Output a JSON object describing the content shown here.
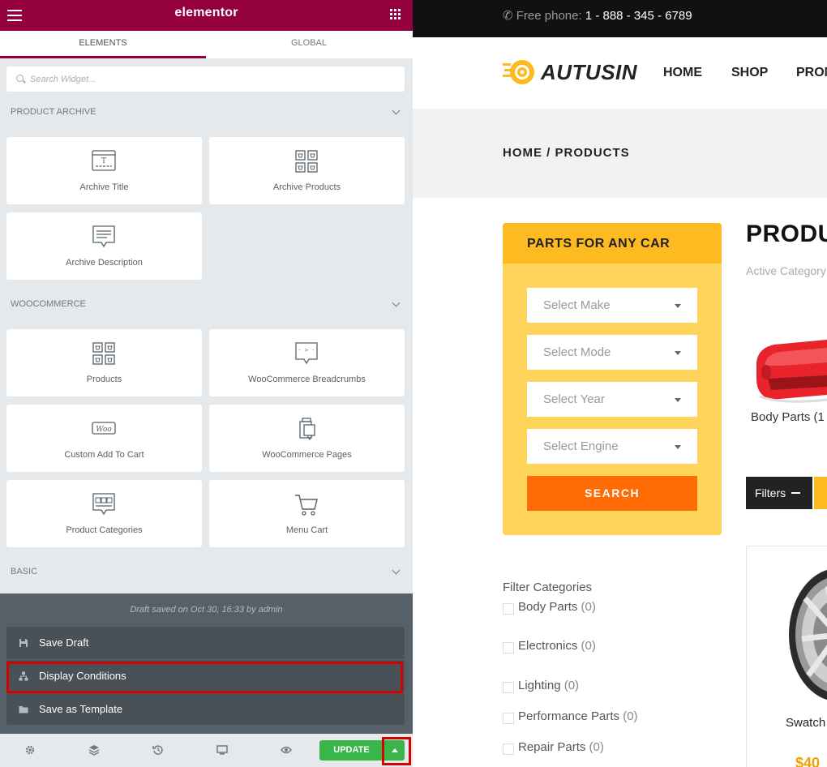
{
  "editor": {
    "brand": "elementor",
    "tabs": {
      "elements": "ELEMENTS",
      "global": "GLOBAL"
    },
    "search_placeholder": "Search Widget...",
    "sections": [
      {
        "title": "PRODUCT ARCHIVE",
        "widgets": [
          "Archive Title",
          "Archive Products",
          "Archive Description"
        ]
      },
      {
        "title": "WOOCOMMERCE",
        "widgets": [
          "Products",
          "WooCommerce Breadcrumbs",
          "Custom Add To Cart",
          "WooCommerce Pages",
          "Product Categories",
          "Menu Cart"
        ]
      },
      {
        "title": "BASIC",
        "widgets": []
      }
    ],
    "draft_note": "Draft saved on Oct 30, 16:33 by admin",
    "menu": {
      "save_draft": "Save Draft",
      "display_conditions": "Display Conditions",
      "save_as_template": "Save as Template"
    },
    "update_label": "UPDATE",
    "bottom_icons": [
      "gear-icon",
      "layers-icon",
      "history-icon",
      "responsive-icon",
      "eye-icon"
    ],
    "colors": {
      "brand": "#93003c",
      "panel_bg": "#e6e9ec",
      "update": "#39b54a",
      "highlight": "#d50000"
    }
  },
  "site": {
    "phone_label": "Free phone:",
    "phone_number": "1 - 888 - 345 - 6789",
    "logo": "AUTUSIN",
    "nav": [
      "HOME",
      "SHOP",
      "PROM"
    ],
    "breadcrumb": {
      "home": "HOME",
      "sep": "/",
      "current": "PRODUCTS"
    },
    "parts_box": {
      "title": "PARTS FOR ANY CAR",
      "selects": [
        "Select Make",
        "Select Mode",
        "Select Year",
        "Select Engine"
      ],
      "search": "SEARCH"
    },
    "products_title": "PRODU",
    "active_category": "Active Category",
    "category_tile": {
      "name": "Body Parts",
      "count": "(1"
    },
    "filters_label": "Filters",
    "filter_categories_title": "Filter Categories",
    "filter_categories": [
      {
        "name": "Body Parts",
        "count": "(0)"
      },
      {
        "name": "Electronics",
        "count": "(0)"
      },
      {
        "name": "Lighting",
        "count": "(0)"
      },
      {
        "name": "Performance Parts",
        "count": "(0)"
      },
      {
        "name": "Repair Parts",
        "count": "(0)"
      }
    ],
    "product_card": {
      "title": "Swatch",
      "price": "$40"
    },
    "colors": {
      "topbar": "#111111",
      "accent_yellow": "#fdba21",
      "box_yellow": "#fed55a",
      "search_orange": "#ff6b05"
    }
  }
}
